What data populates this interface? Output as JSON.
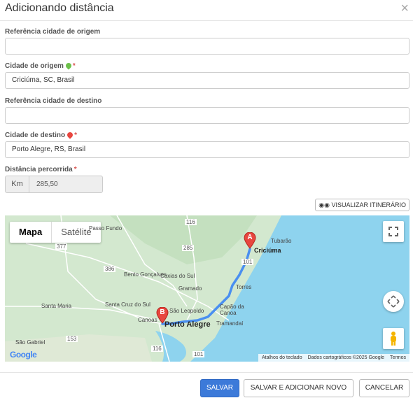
{
  "dialog": {
    "title": "Adicionando distância",
    "close_symbol": "×"
  },
  "form": {
    "origin_reference": {
      "label": "Referência cidade de origem",
      "value": ""
    },
    "origin_city": {
      "label": "Cidade de origem",
      "required_mark": "*",
      "value": "Criciúma, SC, Brasil",
      "pin_color": "#6cc04a"
    },
    "destination_reference": {
      "label": "Referência cidade de destino",
      "value": ""
    },
    "destination_city": {
      "label": "Cidade de destino",
      "required_mark": "*",
      "value": "Porto Alegre, RS, Brasil",
      "pin_color": "#e8463f"
    },
    "distance": {
      "label": "Distância percorrida",
      "required_mark": "*",
      "unit": "Km",
      "value": "285,50"
    }
  },
  "itinerary_button": {
    "label": "VISUALIZAR ITINERÁRIO",
    "icon": "binoculars-icon"
  },
  "map": {
    "type_controls": {
      "map": "Mapa",
      "satellite": "Satélite"
    },
    "markers": {
      "origin": "A",
      "destination": "B"
    },
    "cities": {
      "criciuma": "Criciúma",
      "porto_alegre": "Porto Alegre",
      "passo_fundo": "Passo Fundo",
      "caxias": "Caxias do Sul",
      "bento": "Bento Gonçalves",
      "gramado": "Gramado",
      "torres": "Torres",
      "tubarao": "Tubarão",
      "santa_maria": "Santa Maria",
      "santa_cruz": "Santa Cruz do Sul",
      "sao_leopoldo": "São Leopoldo",
      "capao": "Capão da Canoa",
      "tramandai": "Tramandaí",
      "canoas": "Canoas",
      "sao_gabriel": "São Gabriel"
    },
    "roads": [
      "116",
      "377",
      "285",
      "386",
      "101",
      "153",
      "116",
      "101"
    ],
    "attribution": {
      "keyboard": "Atalhos do teclado",
      "data": "Dados cartográficos ©2025 Google",
      "terms": "Termos"
    },
    "logo": "Google",
    "route_color": "#4a8ff0",
    "sea_color": "#8ed3ee"
  },
  "footer": {
    "save": "SALVAR",
    "save_and_add": "SALVAR E ADICIONAR NOVO",
    "cancel": "CANCELAR"
  }
}
